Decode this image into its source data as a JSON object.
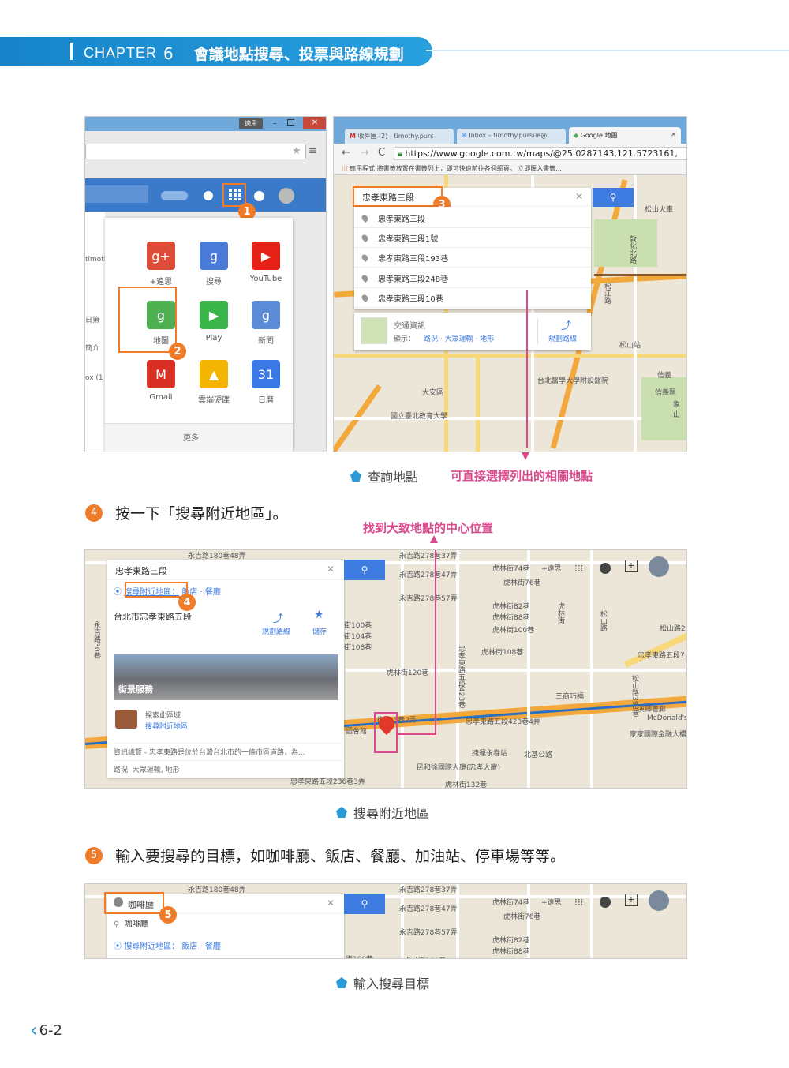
{
  "header": {
    "chapter_word": "CHAPTER",
    "chapter_num": "6",
    "title": "會議地點搜尋、投票與路線規劃"
  },
  "fig1": {
    "left": {
      "window_btn": "適用",
      "apps": [
        {
          "name": "google-plus",
          "label": "+遠思",
          "color": "#dd4b39",
          "glyph": "g+"
        },
        {
          "name": "search",
          "label": "搜尋",
          "color": "#4a7ad8",
          "glyph": "g"
        },
        {
          "name": "youtube",
          "label": "YouTube",
          "color": "#e62117",
          "glyph": "▶"
        },
        {
          "name": "maps",
          "label": "地圖",
          "color": "#4caf50",
          "glyph": "g"
        },
        {
          "name": "play",
          "label": "Play",
          "color": "#3ab54a",
          "glyph": "▶"
        },
        {
          "name": "news",
          "label": "新聞",
          "color": "#5b8bd6",
          "glyph": "g"
        },
        {
          "name": "gmail",
          "label": "Gmail",
          "color": "#d93025",
          "glyph": "M"
        },
        {
          "name": "drive",
          "label": "雲端硬碟",
          "color": "#f4b400",
          "glyph": "▲"
        },
        {
          "name": "calendar",
          "label": "日曆",
          "color": "#3b78e7",
          "glyph": "31"
        }
      ],
      "more": "更多",
      "side_texts": [
        "timotl",
        "日第",
        "簡介",
        "ox (1"
      ],
      "badge1": "1",
      "badge2": "2"
    },
    "right": {
      "tabs": [
        "收件匣 (2) - timothy.purs",
        "Inbox – timothy.pursue@",
        "Google 地圖"
      ],
      "url": "https://www.google.com.tw/maps/@25.0287143,121.5723161,",
      "bookmarks": "應用程式   將書籤放置在書籤列上，即可快速前往各個網頁。 立即匯入書籤...",
      "search_value": "忠孝東路三段",
      "suggestions": [
        "忠孝東路三段",
        "忠孝東路三段1號",
        "忠孝東路三段193巷",
        "忠孝東路三段248巷",
        "忠孝東路三段10巷"
      ],
      "traffic_title": "交通資訊",
      "traffic_show": "顯示：",
      "traffic_links": "路況 · 大眾運輸 · 地形",
      "route": "規劃路線",
      "badge3": "3",
      "map_labels": [
        "松山火車",
        "敦化北路",
        "松江路",
        "信義",
        "松山站",
        "信義區",
        "台北醫學大學附設醫院",
        "國立臺北教育大學",
        "大安區",
        "象山"
      ]
    }
  },
  "caption1": "查詢地點",
  "annotation1": "可直接選擇列出的相關地點",
  "step4": {
    "num": "4",
    "text": "按一下「搜尋附近地區」。"
  },
  "annotation2": "找到大致地點的中心位置",
  "fig2": {
    "search_value": "忠孝東路三段",
    "nearby": "搜尋附近地區：",
    "nearby_links": "飯店 · 餐廳",
    "address": "台北市忠孝東路五段",
    "route": "規劃路線",
    "save": "儲存",
    "street": "街景服務",
    "explore": "探索此區域",
    "explore_link": "搜尋附近地區",
    "info": "資訊總覽 - 忠孝東路是位於台灣台北市的一條市區道路，為...",
    "info2": "路況, 大眾運輸, 地形",
    "badge": "4",
    "map_labels": [
      "永吉路180巷48弄",
      "永吉路278巷47弄",
      "永吉路278巷57弄",
      "虎林街74巷",
      "虎林街76巷",
      "+遠思",
      "虎林街82巷",
      "虎林街88巷",
      "虎林街100巷",
      "虎林街108巷",
      "虎林街120巷",
      "永吉路278巷37弄",
      "忠孝東路五段423巷4弄",
      "忠孝東路五段236巷3弄",
      "虎林街132巷",
      "北基公路",
      "松山路2",
      "忠孝東路五段7",
      "松山路393巷",
      "捷運永春站",
      "民和徐國際大廈(忠孝大廈)",
      "街100巷",
      "街104巷",
      "街108巷",
      "永吉路30巷",
      "松山路",
      "虎林街",
      "忠孝東路五段423巷",
      "三商巧福",
      "演繹書廊",
      "McDonald's",
      "家家國際金融大樓",
      "街295巷2弄",
      "國會館"
    ]
  },
  "caption2": "搜尋附近地區",
  "step5": {
    "num": "5",
    "text": "輸入要搜尋的目標，如咖啡廳、飯店、餐廳、加油站、停車場等等。"
  },
  "fig3": {
    "search_value": "咖啡廳",
    "suggestion": "咖啡廳",
    "nearby": "搜尋附近地區：",
    "nearby_links": "飯店 · 餐廳",
    "badge": "5",
    "map_labels": [
      "永吉路180巷48弄",
      "永吉路278巷47弄",
      "永吉路278巷57弄",
      "虎林街74巷",
      "虎林街76巷",
      "+遠思",
      "虎林街82巷",
      "虎林街88巷",
      "街100巷",
      "虎林街100巷",
      "永吉路278巷37弄"
    ]
  },
  "caption3": "輸入搜尋目標",
  "page_number": "6-2",
  "colors": {
    "accent": "#1f8fcf",
    "orange": "#f07b28",
    "pink": "#d84b8c",
    "map_bg": "#ece6d9",
    "road": "#f3a83b"
  }
}
